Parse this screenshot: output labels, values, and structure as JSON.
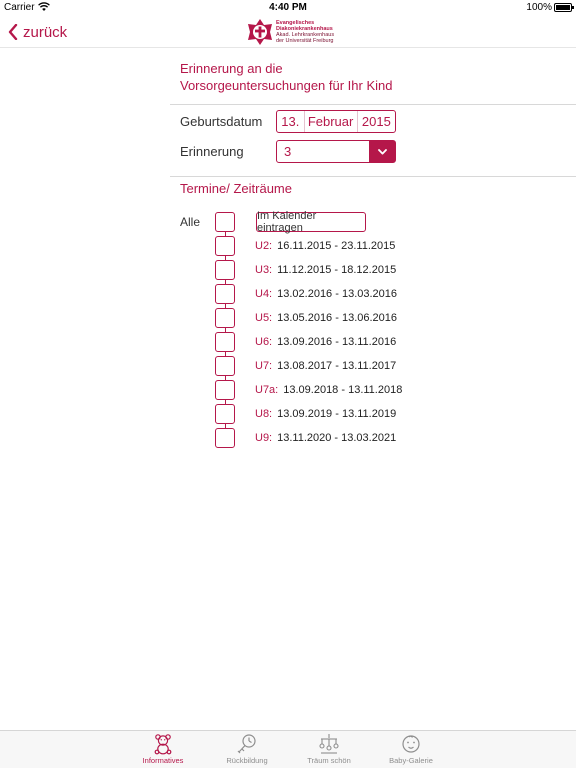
{
  "status_bar": {
    "carrier": "Carrier",
    "time": "4:40 PM",
    "battery": "100%"
  },
  "nav": {
    "back_label": "zurück",
    "logo_lines": [
      "Evangelisches",
      "Diakoniekrankenhaus",
      "Akad. Lehrkrankenhaus",
      "der Universität Freiburg"
    ]
  },
  "heading": {
    "line1": "Erinnerung an die",
    "line2": "Vorsorgeuntersuchungen für Ihr Kind"
  },
  "form": {
    "birthdate_label": "Geburtsdatum",
    "birthdate": {
      "day": "13.",
      "month": "Februar",
      "year": "2015"
    },
    "reminder_label": "Erinnerung",
    "reminder_value": "3"
  },
  "appointments": {
    "title": "Termine/ Zeiträume",
    "all_label": "Alle",
    "calendar_button": "Im Kalender eintragen",
    "items": [
      {
        "code": "U2:",
        "range": "16.11.2015 - 23.11.2015"
      },
      {
        "code": "U3:",
        "range": "11.12.2015 - 18.12.2015"
      },
      {
        "code": "U4:",
        "range": "13.02.2016 - 13.03.2016"
      },
      {
        "code": "U5:",
        "range": "13.05.2016 - 13.06.2016"
      },
      {
        "code": "U6:",
        "range": "13.09.2016 - 13.11.2016"
      },
      {
        "code": "U7:",
        "range": "13.08.2017 - 13.11.2017"
      },
      {
        "code": "U7a:",
        "range": "13.09.2018 - 13.11.2018"
      },
      {
        "code": "U8:",
        "range": "13.09.2019 - 13.11.2019"
      },
      {
        "code": "U9:",
        "range": "13.11.2020 - 13.03.2021"
      }
    ]
  },
  "tabs": [
    {
      "label": "Informatives",
      "icon": "teddy-bear-icon",
      "active": true
    },
    {
      "label": "Rückbildung",
      "icon": "stopwatch-icon",
      "active": false
    },
    {
      "label": "Träum schön",
      "icon": "mobile-toy-icon",
      "active": false
    },
    {
      "label": "Baby-Galerie",
      "icon": "baby-face-icon",
      "active": false
    }
  ],
  "colors": {
    "accent": "#b5174a",
    "divider": "#d8d8d8",
    "tab_inactive": "#8e8e8e"
  }
}
